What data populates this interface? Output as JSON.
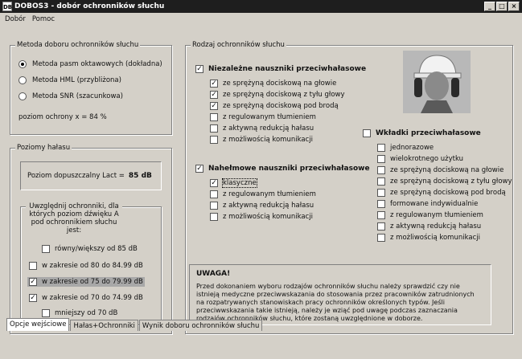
{
  "window": {
    "icon": "DB",
    "title": "DOBOS3 - dobór ochronników słuchu",
    "min": "_",
    "max": "□",
    "close": "×"
  },
  "menu": [
    "Dobór",
    "Pomoc"
  ],
  "method": {
    "legend": "Metoda doboru ochronników słuchu",
    "options": [
      "Metoda pasm oktawowych (dokładna)",
      "Metoda HML (przybliżona)",
      "Metoda SNR (szacunkowa)"
    ],
    "selected": 0,
    "protection": "poziom ochrony   x =  84  %"
  },
  "noise": {
    "legend": "Poziomy hałasu",
    "allowed_label": "Poziom dopuszczalny  Lact =",
    "allowed_value": "85  dB",
    "consider_text": "Uwzględnij ochronniki, dla których poziom dźwięku A pod ochronnikiem słuchu jest:",
    "ranges": [
      {
        "label": "równy/większy od 85 dB",
        "checked": false
      },
      {
        "label": "w zakresie od 80 do 84.99 dB",
        "checked": false
      },
      {
        "label": "w zakresie od 75 do 79.99 dB",
        "checked": true
      },
      {
        "label": "w zakresie od 70 do 74.99 dB",
        "checked": true
      },
      {
        "label": "mniejszy od 70 dB",
        "checked": false
      }
    ]
  },
  "types": {
    "legend": "Rodzaj ochronników słuchu",
    "independent": {
      "label": "Niezależne nauszniki przeciwhałasowe",
      "checked": true,
      "items": [
        {
          "label": "ze sprężyną dociskową na głowie",
          "checked": true
        },
        {
          "label": "ze sprężyną dociskową z tyłu głowy",
          "checked": true
        },
        {
          "label": "ze sprężyną dociskową pod brodą",
          "checked": true
        },
        {
          "label": "z regulowanym tłumieniem",
          "checked": false
        },
        {
          "label": "z aktywną redukcją hałasu",
          "checked": false
        },
        {
          "label": "z możliwością komunikacji",
          "checked": false
        }
      ]
    },
    "helmet": {
      "label": "Nahełmowe nauszniki przeciwhałasowe",
      "checked": true,
      "items": [
        {
          "label": "klasyczne",
          "checked": true
        },
        {
          "label": "z regulowanym tłumieniem",
          "checked": false
        },
        {
          "label": "z aktywną redukcją hałasu",
          "checked": false
        },
        {
          "label": "z możliwością komunikacji",
          "checked": false
        }
      ]
    },
    "plugs": {
      "label": "Wkładki przeciwhałasowe",
      "checked": false,
      "items": [
        {
          "label": "jednorazowe",
          "checked": false
        },
        {
          "label": "wielokrotnego użytku",
          "checked": false
        },
        {
          "label": "ze sprężyną dociskową na głowie",
          "checked": false
        },
        {
          "label": "ze sprężyną dociskową z tyłu głowy",
          "checked": false
        },
        {
          "label": "ze sprężyną dociskową pod brodą",
          "checked": false
        },
        {
          "label": "formowane indywidualnie",
          "checked": false
        },
        {
          "label": "z regulowanym tłumieniem",
          "checked": false
        },
        {
          "label": "z aktywną redukcją hałasu",
          "checked": false
        },
        {
          "label": "z możliwością komunikacji",
          "checked": false
        }
      ]
    }
  },
  "warning": {
    "title": "UWAGA!",
    "text": "Przed dokonaniem wyboru rodzajów ochronników słuchu należy sprawdzić czy nie istnieją medyczne przeciwwskazania do stosowania przez pracowników zatrudnionych na rozpatrywanych stanowiskach pracy ochronników określonych typów. Jeśli przeciwwskazania takie istnieją, należy je wziąć pod uwagę podczas zaznaczania rodzajów ochronników słuchu, które zostaną uwzględnione w doborze."
  },
  "tabs": [
    "Opcje wejściowe",
    "Hałas+Ochronniki",
    "Wynik doboru ochronników słuchu"
  ],
  "active_tab": 0
}
